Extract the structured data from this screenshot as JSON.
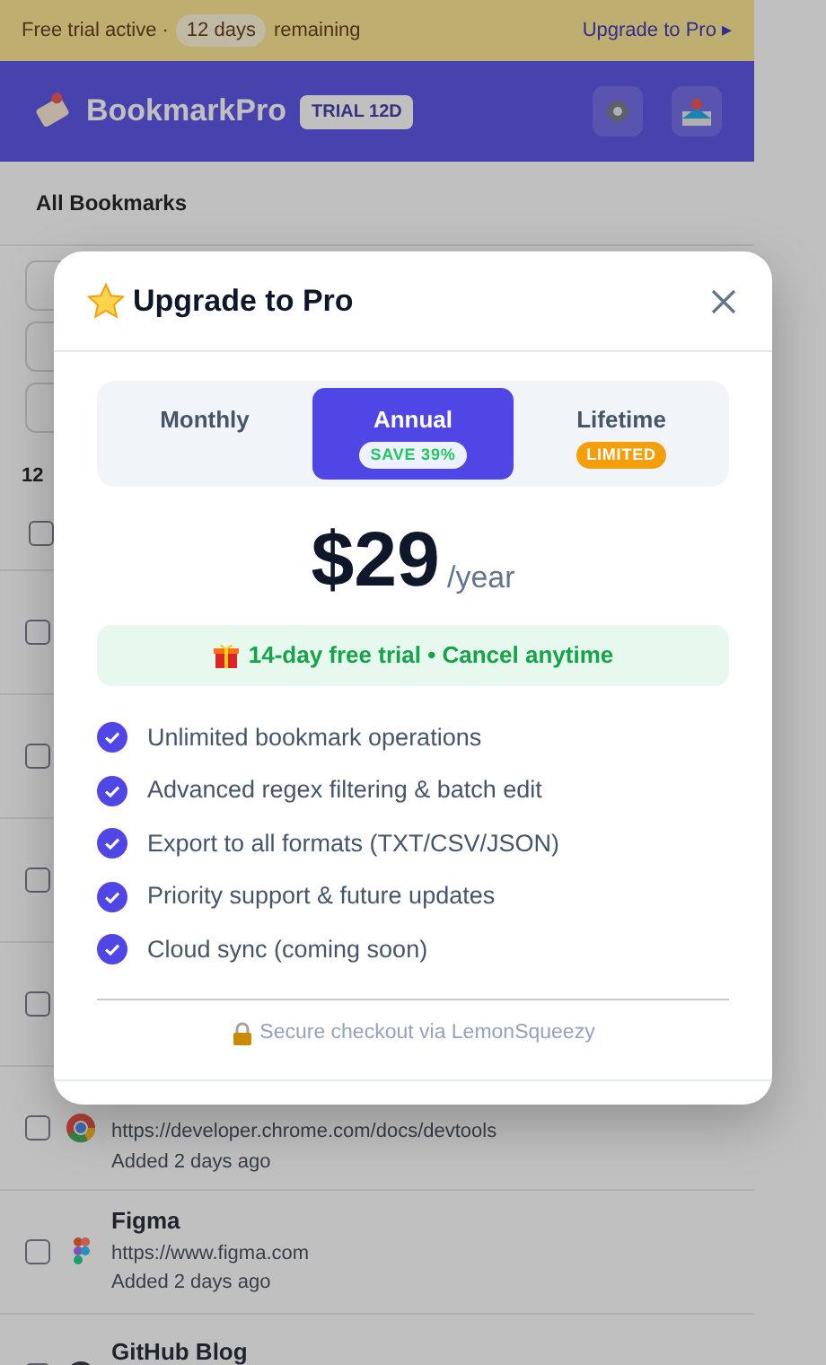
{
  "trial_bar": {
    "text": "Free trial active ·",
    "days": "12 days",
    "suffix": "remaining",
    "link": "Upgrade to Pro ▸"
  },
  "header": {
    "app_name": "BookmarkPro",
    "badge": "TRIAL 12D"
  },
  "section_title": "All Bookmarks",
  "list": {
    "count": "12",
    "select_all_checked": false,
    "bookmarks": [
      {
        "checked": false
      },
      {
        "checked": false
      },
      {
        "checked": false
      },
      {
        "checked": false
      },
      {
        "checked": false,
        "kind": "chrome",
        "url": "https://developer.chrome.com/docs/devtools",
        "added": "Added 2 days ago"
      },
      {
        "checked": false,
        "kind": "figma",
        "title": "Figma",
        "url": "https://www.figma.com",
        "added": "Added 2 days ago"
      },
      {
        "checked": false,
        "kind": "github",
        "title": "GitHub Blog"
      }
    ]
  },
  "modal": {
    "title": "Upgrade to Pro",
    "plans": [
      {
        "label": "Monthly",
        "selected": false
      },
      {
        "label": "Annual",
        "selected": true,
        "badge": {
          "text": "SAVE 39%",
          "kind": "save"
        }
      },
      {
        "label": "Lifetime",
        "selected": false,
        "badge": {
          "text": "LIMITED",
          "kind": "limited"
        }
      }
    ],
    "price": "$29",
    "period": "/year",
    "trial_note": "14-day free trial • Cancel anytime",
    "features": [
      "Unlimited bookmark operations",
      "Advanced regex filtering & batch edit",
      "Export to all formats (TXT/CSV/JSON)",
      "Priority support & future updates",
      "Cloud sync (coming soon)"
    ],
    "footer_note": "Secure checkout via LemonSqueezy"
  }
}
